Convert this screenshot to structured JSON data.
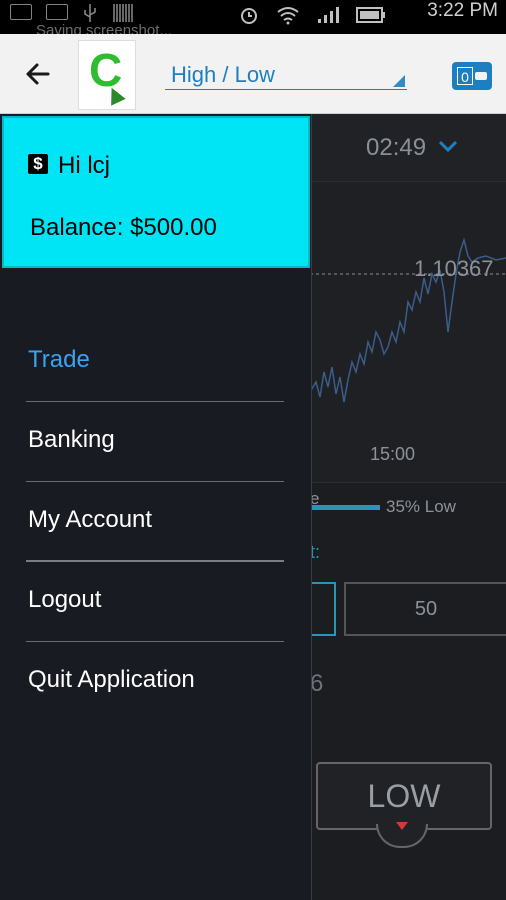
{
  "status_bar": {
    "time": "3:22 PM",
    "ghost_notification": "Saving screenshot..."
  },
  "app_bar": {
    "logo_letter": "C",
    "mode": "High / Low",
    "wallet_count": "0",
    "accent_color": "#1d7fbf"
  },
  "drawer": {
    "greeting": "Hi lcj",
    "balance": "Balance: $500.00",
    "profile_color": "#00e5f6",
    "menu_items": [
      {
        "label": "Trade",
        "active": true
      },
      {
        "label": "Banking",
        "active": false
      },
      {
        "label": "My Account",
        "active": false
      },
      {
        "label": "Logout",
        "active": false
      },
      {
        "label": "Quit Application",
        "active": false
      }
    ]
  },
  "background_screen": {
    "timer": "02:49",
    "price": "1.10367",
    "time_axis_label": "15:00",
    "sentiment_left": "e",
    "sentiment_right": "35% Low",
    "amount_label": "t:",
    "amount_option": "50",
    "payout_fragment": "6",
    "low_button": "LOW"
  }
}
